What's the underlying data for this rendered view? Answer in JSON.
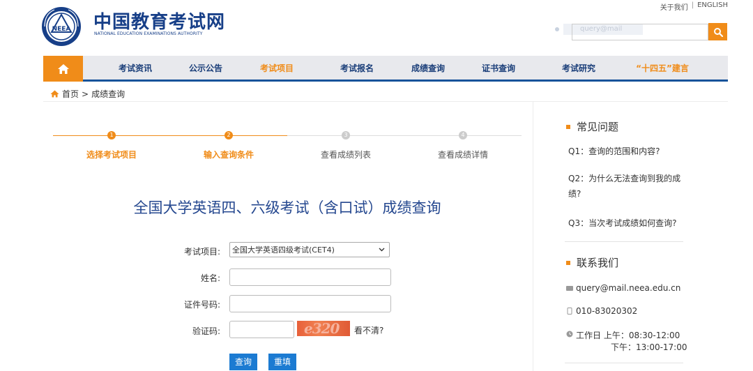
{
  "header": {
    "top_links": [
      "关于我们",
      "ENGLISH"
    ],
    "top_links_sep": "|",
    "logo_cn": "中国教育考试网",
    "logo_en": "NATIONAL EDUCATION EXAMINATIONS AUTHORITY",
    "logo_seal_text": "NEEA",
    "search_ghost": "query@mail",
    "search_value": ""
  },
  "nav": {
    "items": [
      "考试资讯",
      "公示公告",
      "考试项目",
      "考试报名",
      "成绩查询",
      "证书查询",
      "考试研究",
      "“十四五”建言"
    ],
    "active_index": 2,
    "highlight_index": 7
  },
  "breadcrumb": {
    "home": "首页",
    "sep": ">",
    "current": "成绩查询"
  },
  "steps": [
    {
      "num": "1",
      "label": "选择考试项目",
      "state": "done"
    },
    {
      "num": "2",
      "label": "输入查询条件",
      "state": "done"
    },
    {
      "num": "3",
      "label": "查看成绩列表",
      "state": "todo"
    },
    {
      "num": "4",
      "label": "查看成绩详情",
      "state": "todo"
    }
  ],
  "form": {
    "title": "全国大学英语四、六级考试（含口试）成绩查询",
    "exam_label": "考试项目:",
    "exam_value": "全国大学英语四级考试(CET4)",
    "name_label": "姓名:",
    "id_label": "证件号码:",
    "captcha_label": "验证码:",
    "captcha_text": "e320",
    "refresh_label": "看不清?",
    "submit_label": "查询",
    "reset_label": "重填"
  },
  "sidebar": {
    "faq_title": "常见问题",
    "faqs": [
      "Q1：查询的范围和内容?",
      "Q2：为什么无法查询到我的成绩?",
      "Q3：当次考试成绩如何查询?"
    ],
    "contact_title": "联系我们",
    "email": "query@mail.neea.edu.cn",
    "phone": "010-83020302",
    "hours_am": "工作日 上午：08:30-12:00",
    "hours_pm": "下午：13:00-17:00"
  },
  "colors": {
    "accent": "#f08c19",
    "brand_blue": "#17539a",
    "title_blue": "#24478f",
    "button_blue": "#1c7bd2"
  }
}
